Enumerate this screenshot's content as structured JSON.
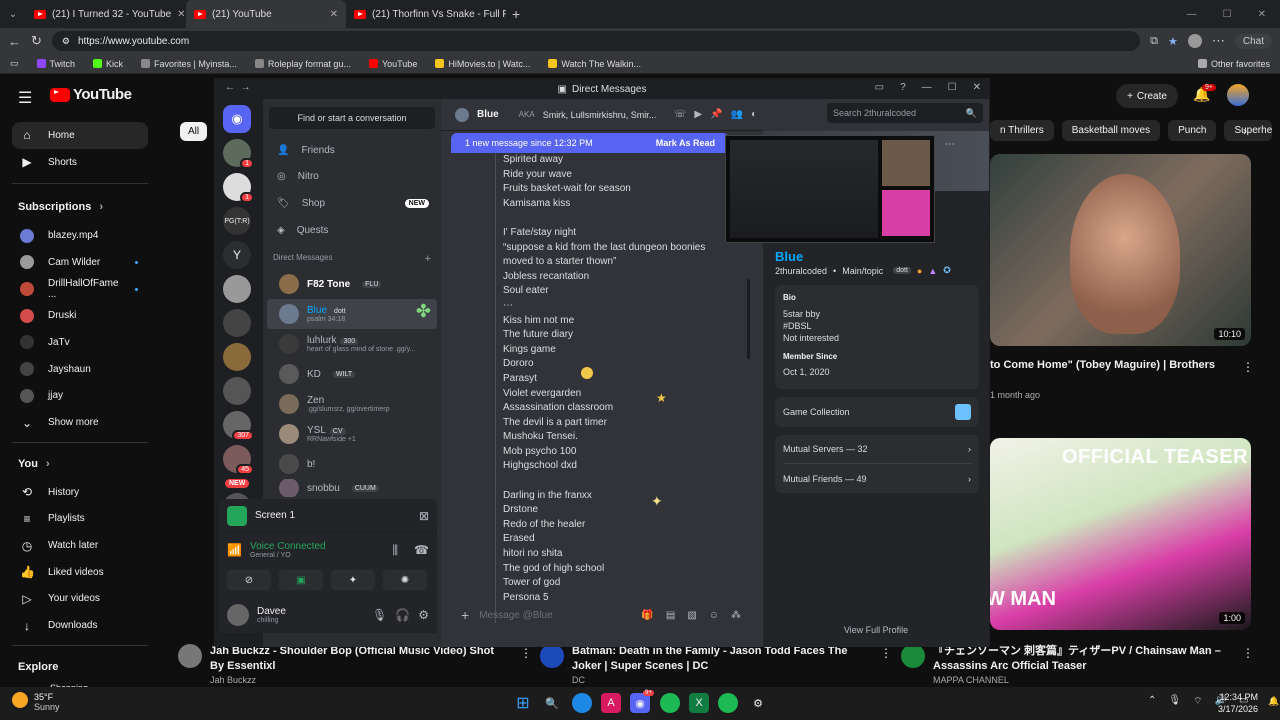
{
  "browser": {
    "tabs": [
      {
        "title": "(21) I Turned 32 - YouTube"
      },
      {
        "title": "(21) YouTube"
      },
      {
        "title": "(21) Thorfinn Vs Snake - Full Fight"
      }
    ],
    "url": "https://www.youtube.com",
    "chat_label": "Chat",
    "bookmarks": [
      {
        "label": "Twitch",
        "color": "#9146ff"
      },
      {
        "label": "Kick",
        "color": "#53fc18"
      },
      {
        "label": "Favorites | Myinsta...",
        "color": "#888888"
      },
      {
        "label": "Roleplay format gu...",
        "color": "#888888"
      },
      {
        "label": "YouTube",
        "color": "#ff0000"
      },
      {
        "label": "HiMovies.to | Watc...",
        "color": "#f5c518"
      },
      {
        "label": "Watch The Walkin...",
        "color": "#f5c518"
      }
    ],
    "other_favorites": "Other favorites"
  },
  "youtube": {
    "logo": "YouTube",
    "create": "Create",
    "notif_count": "9+",
    "all_chip": "All",
    "chips": [
      "n Thrillers",
      "Basketball moves",
      "Punch",
      "Superhe"
    ],
    "nav_main": [
      {
        "label": "Home",
        "icon": "home-icon"
      },
      {
        "label": "Shorts",
        "icon": "shorts-icon"
      }
    ],
    "subscriptions_header": "Subscriptions",
    "subscriptions": [
      {
        "label": "blazey.mp4",
        "color": "#6b7bd6",
        "dot": false
      },
      {
        "label": "Cam Wilder",
        "color": "#9a9a9a",
        "dot": true
      },
      {
        "label": "DrillHallOfFame ...",
        "color": "#c04a3a",
        "dot": true
      },
      {
        "label": "Druski",
        "color": "#d44b4b",
        "dot": false
      },
      {
        "label": "JaTv",
        "color": "#333333",
        "dot": false
      },
      {
        "label": "Jayshaun",
        "color": "#444444",
        "dot": false
      },
      {
        "label": "jjay",
        "color": "#555555",
        "dot": false
      }
    ],
    "show_more": "Show more",
    "you_header": "You",
    "you_items": [
      {
        "label": "History",
        "icon": "history-icon"
      },
      {
        "label": "Playlists",
        "icon": "playlists-icon"
      },
      {
        "label": "Watch later",
        "icon": "watch-later-icon"
      },
      {
        "label": "Liked videos",
        "icon": "liked-icon"
      },
      {
        "label": "Your videos",
        "icon": "your-videos-icon"
      },
      {
        "label": "Downloads",
        "icon": "downloads-icon"
      }
    ],
    "explore_header": "Explore",
    "explore_partial": "Shopping",
    "video1": {
      "title": "to Come Home\" (Tobey Maguire) | Brothers",
      "meta": "1 month ago",
      "duration": "10:10"
    },
    "video2": {
      "overlay": "OFFICIAL TEASER",
      "overlay2": "W MAN",
      "duration": "1:00"
    },
    "bottom_videos": [
      {
        "title": "Jah Buckzz - Shoulder Bop (Official Music Video) Shot By Essentixl",
        "channel": "Jah Buckzz"
      },
      {
        "title": "Batman: Death in the Family - Jason Todd Faces The Joker | Super Scenes | DC",
        "channel": "DC"
      },
      {
        "title": "『チェンソーマン 刺客篇』ティザーPV / Chainsaw Man – Assassins Arc Official Teaser",
        "channel": "MAPPA CHANNEL"
      }
    ]
  },
  "discord": {
    "window_title": "Direct Messages",
    "find_placeholder": "Find or start a conversation",
    "top_nav": [
      {
        "label": "Friends",
        "icon": "friends-icon"
      },
      {
        "label": "Nitro",
        "icon": "nitro-icon"
      },
      {
        "label": "Shop",
        "icon": "shop-icon",
        "badge": "NEW"
      },
      {
        "label": "Quests",
        "icon": "quests-icon"
      }
    ],
    "dm_header": "Direct Messages",
    "dms": [
      {
        "name": "F82 Tone",
        "tag": "FLU",
        "sub": "",
        "color": "#8a6d4b"
      },
      {
        "name": "Blue",
        "tag": "dott",
        "sub": "psalm 34:18",
        "color": "#6b7a8f"
      },
      {
        "name": "luhlurk",
        "tag": "300",
        "sub": "heart of glass mind of stone .gg/y...",
        "color": "#3b3b3b"
      },
      {
        "name": "KD",
        "tag": "WILT",
        "sub": "",
        "color": "#5a5a5a"
      },
      {
        "name": "Zen",
        "tag": "",
        "sub": ".gg/slumsrz, gg/overtimerp",
        "color": "#7a6a5a"
      },
      {
        "name": "YSL",
        "tag": "CV",
        "sub": "RRNawfside +1",
        "color": "#9a8a7a"
      },
      {
        "name": "b!",
        "tag": "",
        "sub": "",
        "color": "#4a4a4a"
      },
      {
        "name": "snobbu",
        "tag": "CUUM",
        "sub": "",
        "color": "#6a5a6a"
      }
    ],
    "server_badges": [
      "1",
      "1",
      "307",
      "45",
      "162"
    ],
    "server_new": "NEW",
    "screen_share": "Screen 1",
    "voice_status": "Voice Connected",
    "voice_channel": "General / YO",
    "user_name": "Davee",
    "user_status": "chilling",
    "chat_user": "Blue",
    "aka_label": "AKA",
    "aka_names": "Smirk, Lullsmirkishru, Smir...",
    "search_placeholder": "Search 2thuralcoded",
    "banner_text": "1 new message since 12:32 PM",
    "banner_action": "Mark As Read",
    "messages": [
      "Spirited away",
      "Ride your wave",
      "Fruits basket-wait for season",
      "Kamisama kiss",
      "",
      "I' Fate/stay night",
      "“suppose a kid from the last dungeon boonies moved to a starter thown”",
      "Jobless recantation",
      "Soul eater",
      "⋯",
      "Kiss him not me",
      "The future diary",
      "Kings game",
      "Dororo",
      "Parasyt",
      "Violet evergarden",
      "Assassination classroom",
      "The devil is a part timer",
      "Mushoku Tensei.",
      "Mob psycho 100",
      "Highgschool dxd",
      "",
      "Darling in the franxx",
      "Drstone",
      "Redo of the healer",
      "Erased",
      "hitori no shita",
      "The god of high school",
      "Tower of god",
      "Persona 5"
    ],
    "message_placeholder": "Message @Blue",
    "profile": {
      "name": "Blue",
      "handle": "2thuralcoded",
      "extra": "Main/topic",
      "tag": "dott",
      "bio_label": "Bio",
      "bio_lines": [
        "5star bby",
        "#DBSL",
        "Not interested"
      ],
      "member_since_label": "Member Since",
      "member_since": "Oct 1, 2020",
      "game_collection": "Game Collection",
      "mutual_servers": "Mutual Servers — 32",
      "mutual_friends": "Mutual Friends — 49",
      "view_full": "View Full Profile"
    }
  },
  "taskbar": {
    "temp": "35°F",
    "weather": "Sunny",
    "time": "12:34 PM",
    "date": "3/17/2026",
    "discord_badge": "9+"
  }
}
